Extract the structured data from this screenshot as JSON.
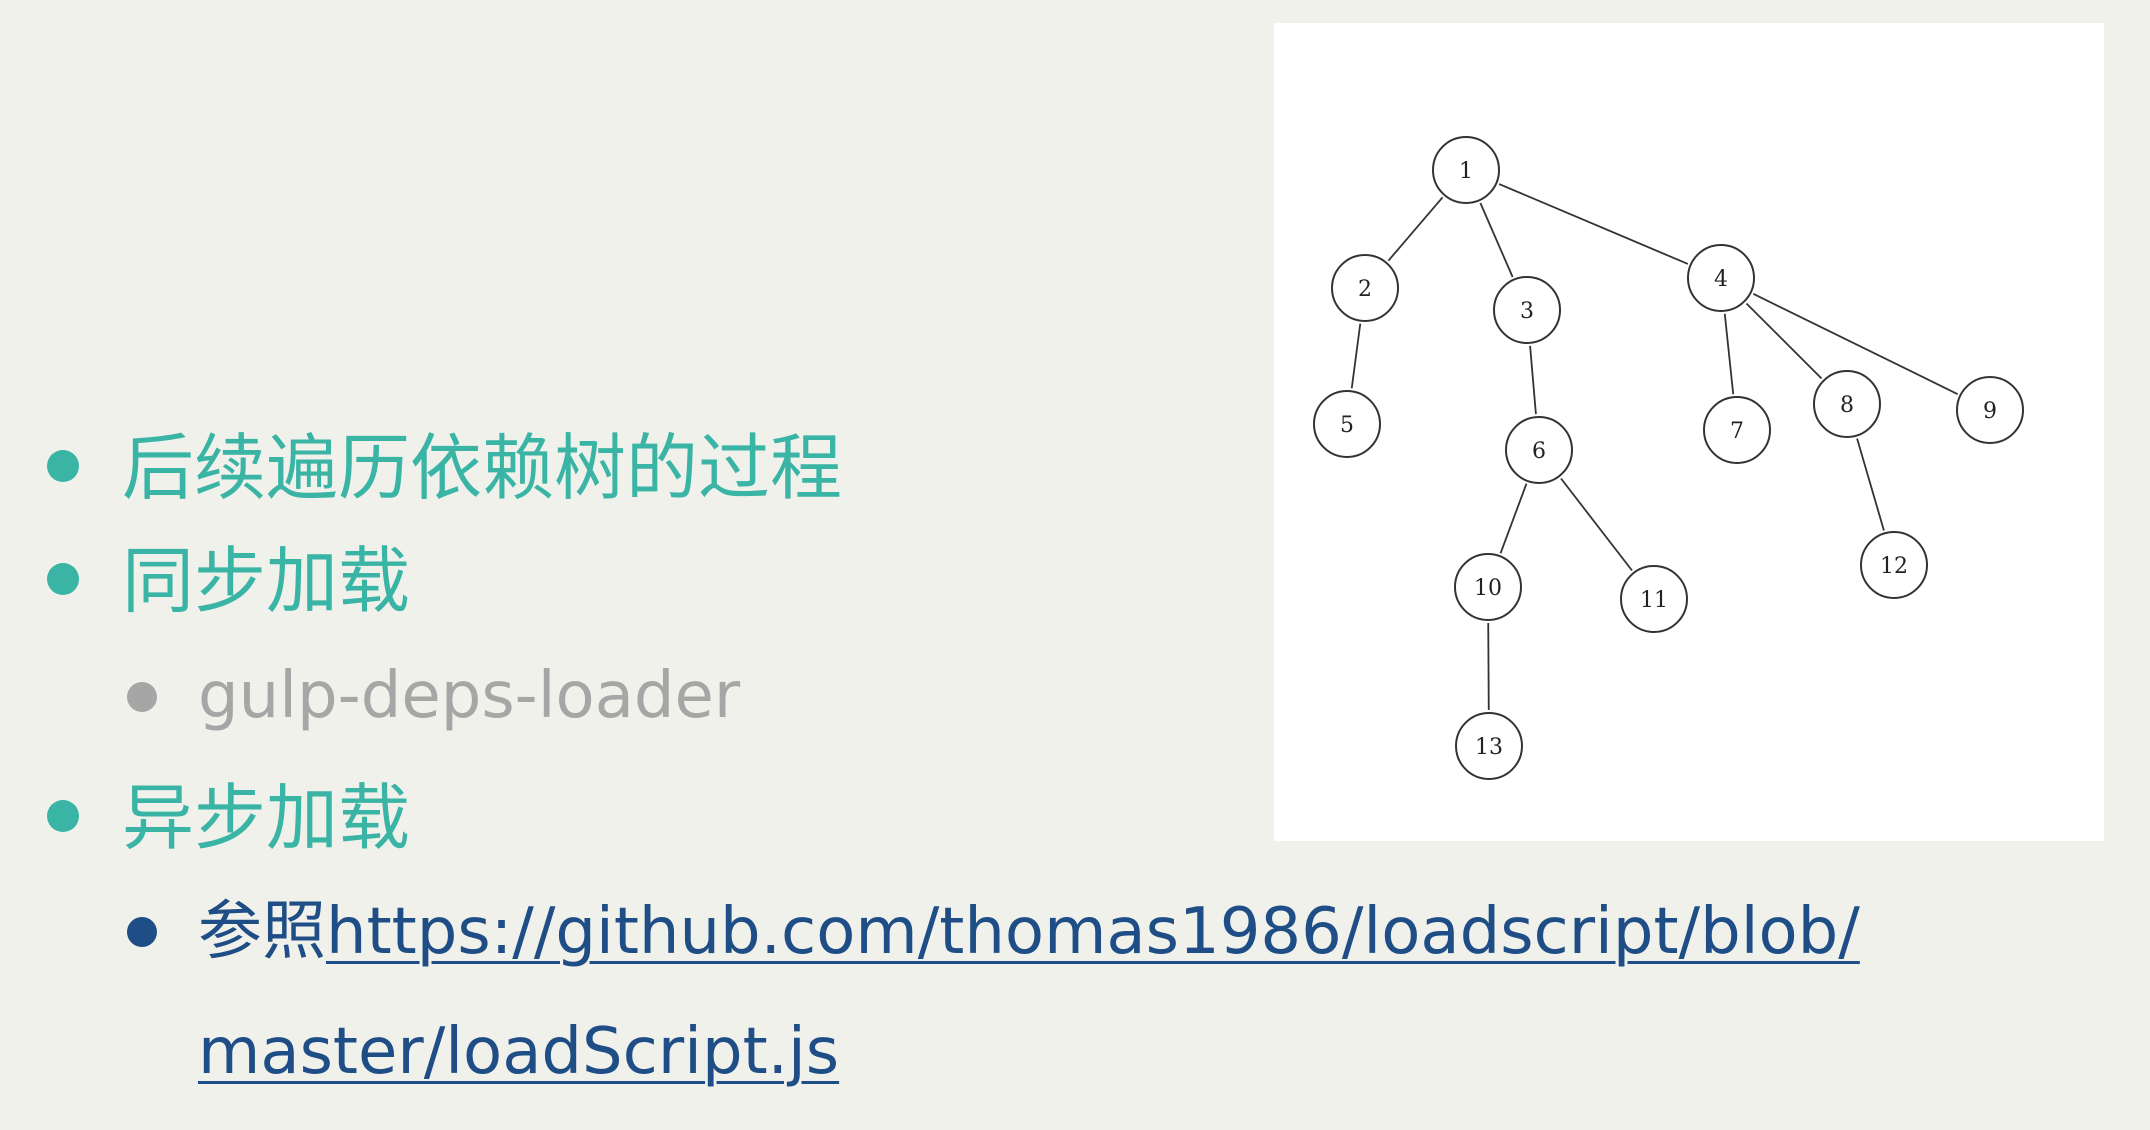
{
  "bullets": {
    "item1": "后续遍历依赖树的过程",
    "item2": "同步加载",
    "item2_sub": "gulp-deps-loader",
    "item3": "异步加载",
    "item3_sub_prefix": "参照",
    "item3_sub_link_line1": "https://github.com/thomas1986/loadscript/blob/",
    "item3_sub_link_line2": "master/loadScript.js"
  },
  "tree": {
    "nodes": [
      "1",
      "2",
      "3",
      "4",
      "5",
      "6",
      "7",
      "8",
      "9",
      "10",
      "11",
      "12",
      "13"
    ],
    "edges": [
      [
        "1",
        "2"
      ],
      [
        "1",
        "3"
      ],
      [
        "1",
        "4"
      ],
      [
        "2",
        "5"
      ],
      [
        "3",
        "6"
      ],
      [
        "4",
        "7"
      ],
      [
        "4",
        "8"
      ],
      [
        "4",
        "9"
      ],
      [
        "6",
        "10"
      ],
      [
        "6",
        "11"
      ],
      [
        "8",
        "12"
      ],
      [
        "10",
        "13"
      ]
    ]
  },
  "colors": {
    "background": "#f1f1ec",
    "accent_teal": "#3ab4a5",
    "sub_gray": "#a6a6a6",
    "link_blue": "#1f4e86"
  }
}
